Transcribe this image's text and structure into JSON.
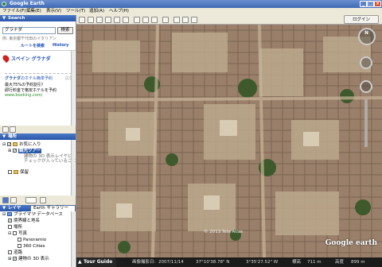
{
  "window": {
    "title": "Google Earth",
    "min": "_",
    "max": "□",
    "close": "×"
  },
  "menu": [
    "ファイル(F)",
    "編集(E)",
    "表示(V)",
    "ツール(T)",
    "追加(A)",
    "ヘルプ(H)"
  ],
  "toolbar": {
    "login_label": "ログイン"
  },
  "search": {
    "header": "Search",
    "query": "グラナダ",
    "button_label": "検索",
    "hint": "例: 東京都千代田のイタリアン",
    "route_link": "ルートを検索",
    "history_link": "History",
    "result_title": "スペイン グラナダ",
    "ad_title": "グラナダ",
    "ad_title_tail": "のホテル簡単予約",
    "ad_tag": "広告",
    "ad_line1": "最大75%の予約割引！",
    "ad_line2": "即行料金で格安ホテルを予約",
    "ad_url": "www.booking.com/"
  },
  "places": {
    "header": "場所",
    "favorites": "お気に入り",
    "sightseeing": "観光ツアー",
    "desc1": "建物の 3D 表示レイヤに",
    "desc2": "チェックが入っていることを",
    "saved": "保留"
  },
  "layers": {
    "header": "レイヤ",
    "gallery_tab": "Earth ギャラリー",
    "gallery_arrow": "»",
    "items": [
      "プライマリ データベース",
      "境界線と地名",
      "場所",
      "写真",
      "Panoramio",
      "360 Cities",
      "道路",
      "建物の 3D 表示"
    ]
  },
  "statusbar": {
    "tour_label": "Tour Guide",
    "date_label": "画像撮影日:",
    "date": "2007/11/14",
    "lat": "37°10'38.78\" N",
    "lon": "3°35'27.52\" W",
    "elev_label": "標高",
    "elev": "711 m",
    "eye_label": "高度",
    "eye": "899 m"
  },
  "map": {
    "copyright": "© 2013 Tele Atlas",
    "logo": "Google earth",
    "compass_n": "N"
  }
}
